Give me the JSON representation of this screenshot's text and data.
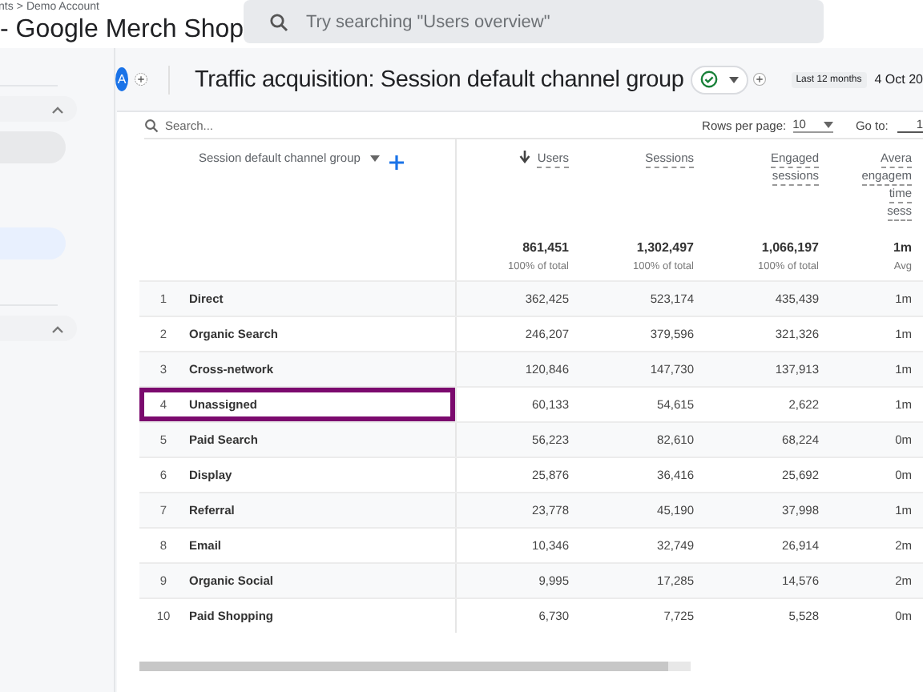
{
  "header": {
    "breadcrumb": [
      "nts",
      ">",
      "Demo Account"
    ],
    "property": "- Google Merch Shop",
    "search": {
      "placeholder": "Try searching \"Users overview\""
    }
  },
  "toolbar": {
    "avatar": "A",
    "title": "Traffic acquisition: Session default channel group",
    "date_badge": "Last 12 months",
    "date": "4 Oct 20"
  },
  "table_controls": {
    "search": {
      "placeholder": "Search..."
    },
    "rows_per_page_label": "Rows per page:",
    "rows_per_page": "10",
    "go_to_label": "Go to:",
    "go_to": "1"
  },
  "table": {
    "dimension_column": "Session default channel group",
    "columns": [
      {
        "lines": [
          "Users"
        ],
        "sorted": true
      },
      {
        "lines": [
          "Sessions"
        ],
        "sorted": false
      },
      {
        "lines": [
          "Engaged",
          "sessions"
        ],
        "sorted": false
      },
      {
        "lines": [
          "Avera",
          "engagem",
          "time",
          "sess"
        ],
        "sorted": false
      }
    ],
    "totals": [
      {
        "value": "861,451",
        "note": "100% of total"
      },
      {
        "value": "1,302,497",
        "note": "100% of total"
      },
      {
        "value": "1,066,197",
        "note": "100% of total"
      },
      {
        "value": "1m",
        "note": "Avg"
      }
    ],
    "rows": [
      {
        "index": "1",
        "name": "Direct",
        "cells": [
          "362,425",
          "523,174",
          "435,439",
          "1m"
        ],
        "highlighted": false
      },
      {
        "index": "2",
        "name": "Organic Search",
        "cells": [
          "246,207",
          "379,596",
          "321,326",
          "1m"
        ],
        "highlighted": false
      },
      {
        "index": "3",
        "name": "Cross-network",
        "cells": [
          "120,846",
          "147,730",
          "137,913",
          "1m"
        ],
        "highlighted": false
      },
      {
        "index": "4",
        "name": "Unassigned",
        "cells": [
          "60,133",
          "54,615",
          "2,622",
          "1m"
        ],
        "highlighted": true
      },
      {
        "index": "5",
        "name": "Paid Search",
        "cells": [
          "56,223",
          "82,610",
          "68,224",
          "0m"
        ],
        "highlighted": false
      },
      {
        "index": "6",
        "name": "Display",
        "cells": [
          "25,876",
          "36,416",
          "25,692",
          "0m"
        ],
        "highlighted": false
      },
      {
        "index": "7",
        "name": "Referral",
        "cells": [
          "23,778",
          "45,190",
          "37,998",
          "1m"
        ],
        "highlighted": false
      },
      {
        "index": "8",
        "name": "Email",
        "cells": [
          "10,346",
          "32,749",
          "26,914",
          "2m"
        ],
        "highlighted": false
      },
      {
        "index": "9",
        "name": "Organic Social",
        "cells": [
          "9,995",
          "17,285",
          "14,576",
          "2m"
        ],
        "highlighted": false
      },
      {
        "index": "10",
        "name": "Paid Shopping",
        "cells": [
          "6,730",
          "7,725",
          "5,528",
          "0m"
        ],
        "highlighted": false
      }
    ]
  }
}
